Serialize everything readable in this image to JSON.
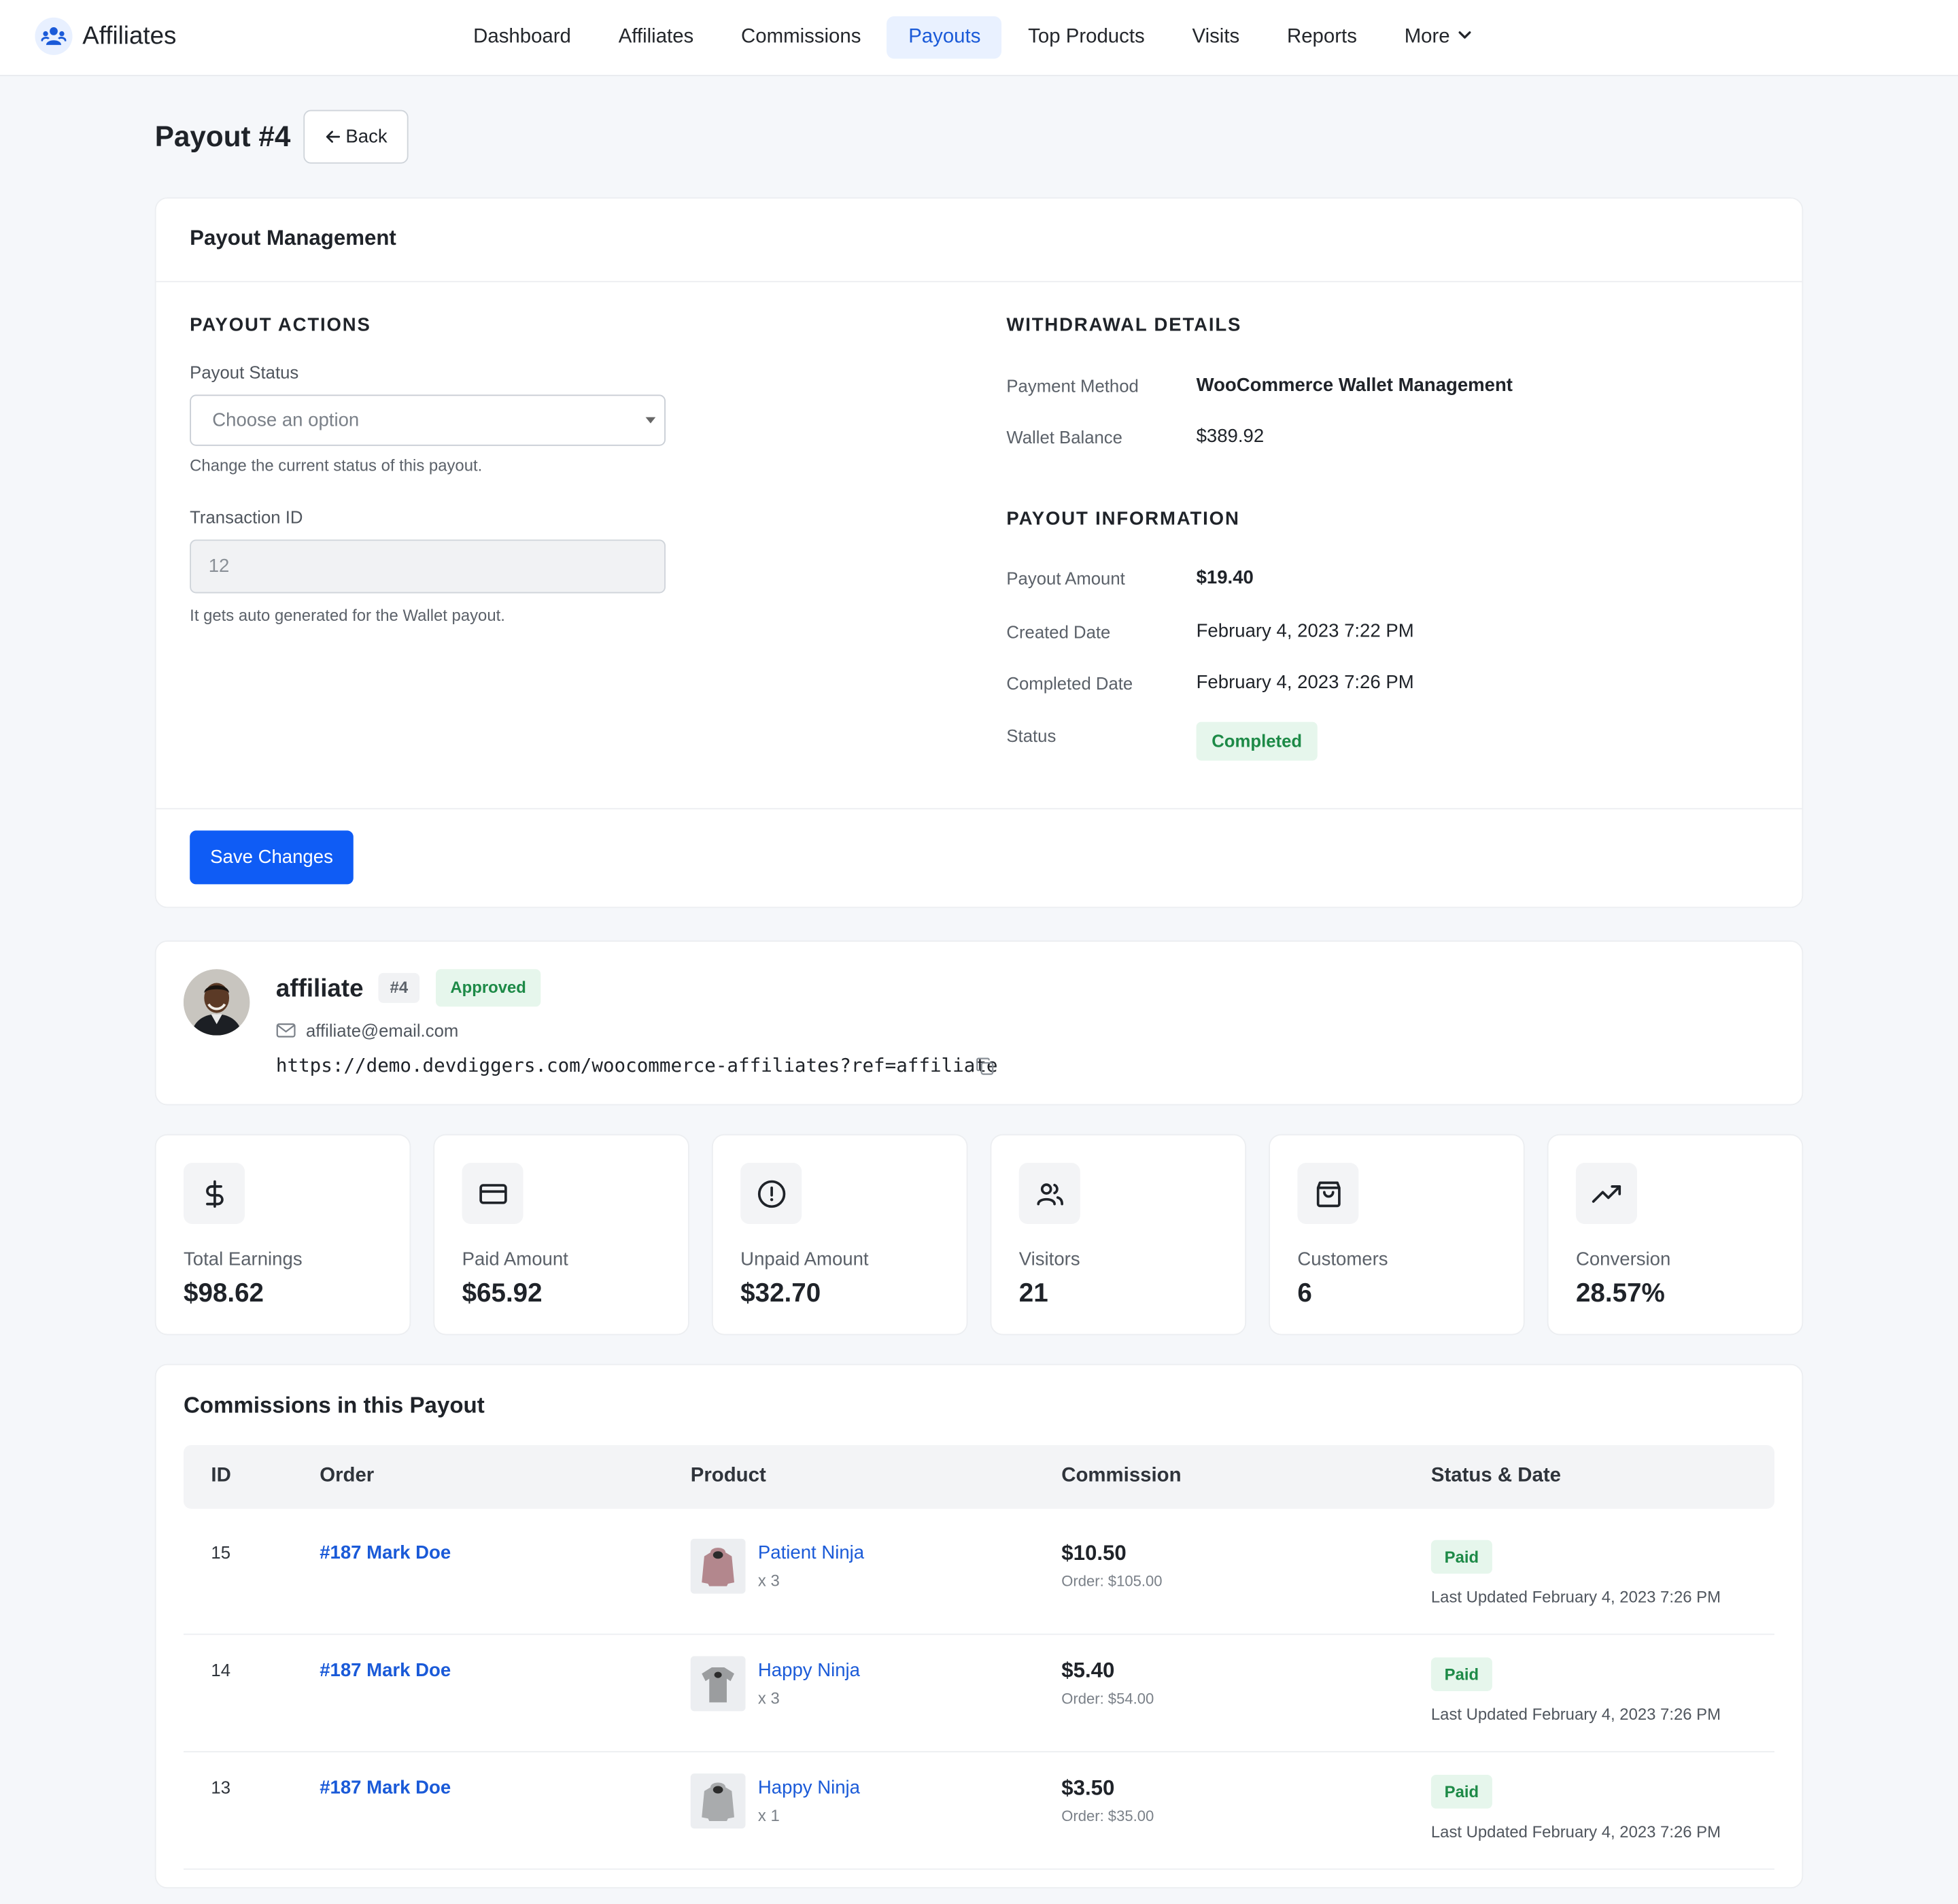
{
  "app": {
    "brand_name": "Affiliates",
    "brand_icon": "affiliate-network-icon",
    "accent_color": "#0f5cf5"
  },
  "nav": {
    "items": [
      {
        "label": "Dashboard"
      },
      {
        "label": "Affiliates"
      },
      {
        "label": "Commissions"
      },
      {
        "label": "Payouts",
        "active": true
      },
      {
        "label": "Top Products"
      },
      {
        "label": "Visits"
      },
      {
        "label": "Reports"
      },
      {
        "label": "More",
        "icon": "chevron-down-icon"
      }
    ]
  },
  "page": {
    "title": "Payout #4",
    "back_label": "Back"
  },
  "management": {
    "title": "Payout Management",
    "actions_title": "PAYOUT ACTIONS",
    "status_label": "Payout Status",
    "status_placeholder": "Choose an option",
    "status_help": "Change the current status of this payout.",
    "txn_label": "Transaction ID",
    "txn_value": "12",
    "txn_help": "It gets auto generated for the Wallet payout.",
    "withdrawal_title": "WITHDRAWAL DETAILS",
    "payment_method_label": "Payment Method",
    "payment_method_value": "WooCommerce Wallet Management",
    "wallet_balance_label": "Wallet Balance",
    "wallet_balance_value": "$389.92",
    "info_title": "PAYOUT INFORMATION",
    "amount_label": "Payout Amount",
    "amount_value": "$19.40",
    "created_label": "Created Date",
    "created_value": "February 4, 2023 7:22 PM",
    "completed_label": "Completed Date",
    "completed_value": "February 4, 2023 7:26 PM",
    "status_field_label": "Status",
    "status_value": "Completed",
    "save_label": "Save Changes"
  },
  "affiliate": {
    "name": "affiliate",
    "id": "#4",
    "status": "Approved",
    "email": "affiliate@email.com",
    "url": "https://demo.devdiggers.com/woocommerce-affiliates?ref=affiliate"
  },
  "stats": [
    {
      "label": "Total Earnings",
      "value": "$98.62",
      "icon": "dollar-icon"
    },
    {
      "label": "Paid Amount",
      "value": "$65.92",
      "icon": "credit-card-icon"
    },
    {
      "label": "Unpaid Amount",
      "value": "$32.70",
      "icon": "alert-circle-icon"
    },
    {
      "label": "Visitors",
      "value": "21",
      "icon": "users-icon"
    },
    {
      "label": "Customers",
      "value": "6",
      "icon": "shopping-bag-icon"
    },
    {
      "label": "Conversion",
      "value": "28.57%",
      "icon": "trending-up-icon"
    }
  ],
  "commissions": {
    "title": "Commissions in this Payout",
    "columns": [
      "ID",
      "Order",
      "Product",
      "Commission",
      "Status & Date"
    ],
    "rows": [
      {
        "id": "15",
        "order": "#187 Mark Doe",
        "product": "Patient Ninja",
        "qty": "x 3",
        "amount": "$10.50",
        "order_total": "Order: $105.00",
        "status": "Paid",
        "updated": "Last Updated February 4, 2023 7:26 PM"
      },
      {
        "id": "14",
        "order": "#187 Mark Doe",
        "product": "Happy Ninja",
        "qty": "x 3",
        "amount": "$5.40",
        "order_total": "Order: $54.00",
        "status": "Paid",
        "updated": "Last Updated February 4, 2023 7:26 PM"
      },
      {
        "id": "13",
        "order": "#187 Mark Doe",
        "product": "Happy Ninja",
        "qty": "x 1",
        "amount": "$3.50",
        "order_total": "Order: $35.00",
        "status": "Paid",
        "updated": "Last Updated February 4, 2023 7:26 PM"
      }
    ]
  }
}
